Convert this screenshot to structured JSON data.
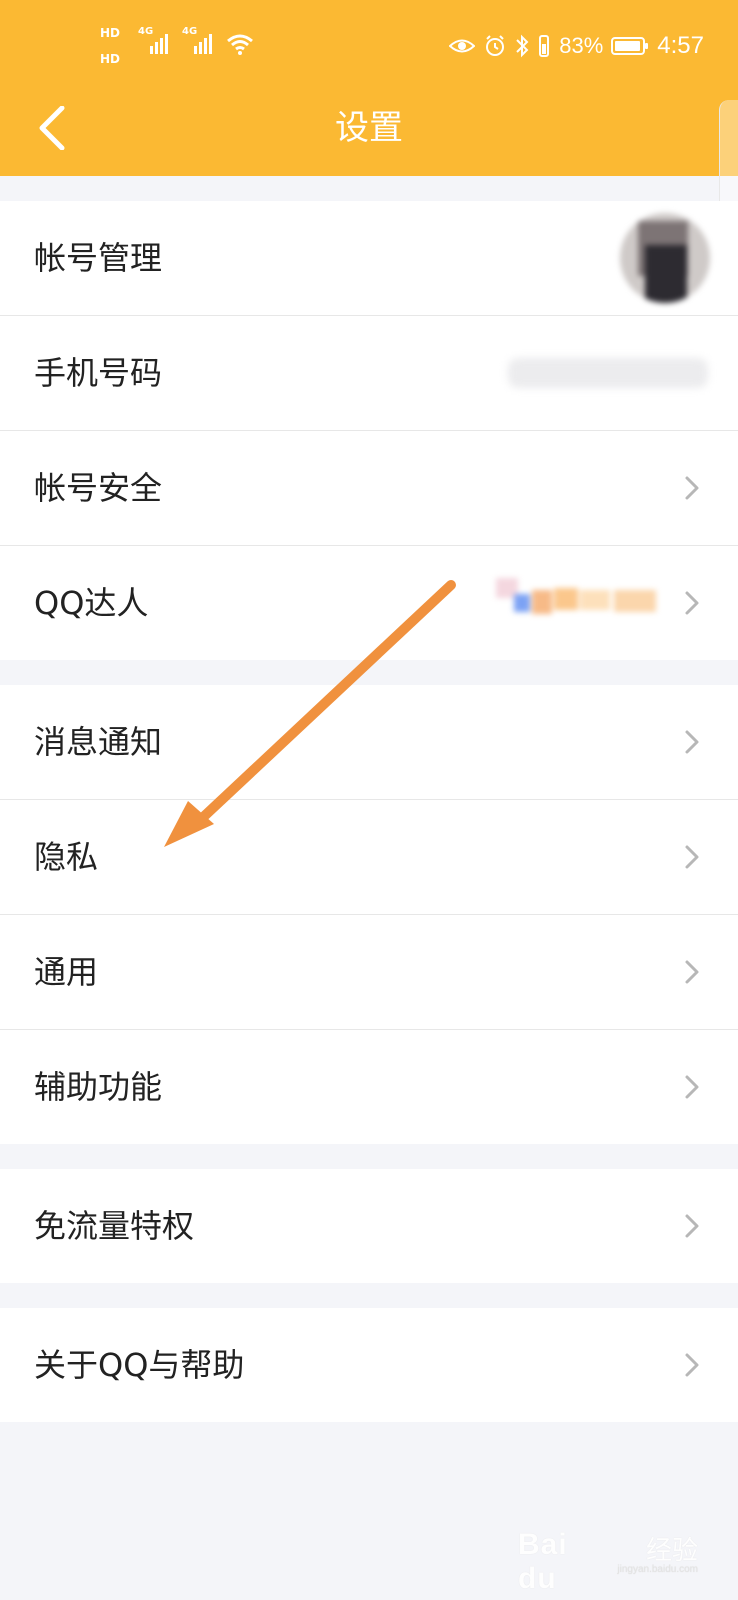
{
  "status_bar": {
    "hd1": "HD",
    "hd2": "HD",
    "signal1_label": "4G",
    "signal2_label": "4G",
    "battery_percent": "83%",
    "time": "4:57"
  },
  "topbar": {
    "title": "设置"
  },
  "groups": [
    {
      "items": [
        {
          "label": "帐号管理"
        },
        {
          "label": "手机号码"
        },
        {
          "label": "帐号安全"
        },
        {
          "label": "QQ达人"
        }
      ]
    },
    {
      "items": [
        {
          "label": "消息通知"
        },
        {
          "label": "隐私"
        },
        {
          "label": "通用"
        },
        {
          "label": "辅助功能"
        }
      ]
    },
    {
      "items": [
        {
          "label": "免流量特权"
        }
      ]
    },
    {
      "items": [
        {
          "label": "关于QQ与帮助"
        }
      ]
    }
  ],
  "watermark": {
    "logo": "Bai du",
    "text": "经验",
    "url": "jingyan.baidu.com"
  },
  "colors": {
    "accent": "#fbb933",
    "arrow": "#f0913e"
  },
  "icons": {
    "back": "chevron-left-icon",
    "row_arrow": "chevron-right-icon"
  }
}
